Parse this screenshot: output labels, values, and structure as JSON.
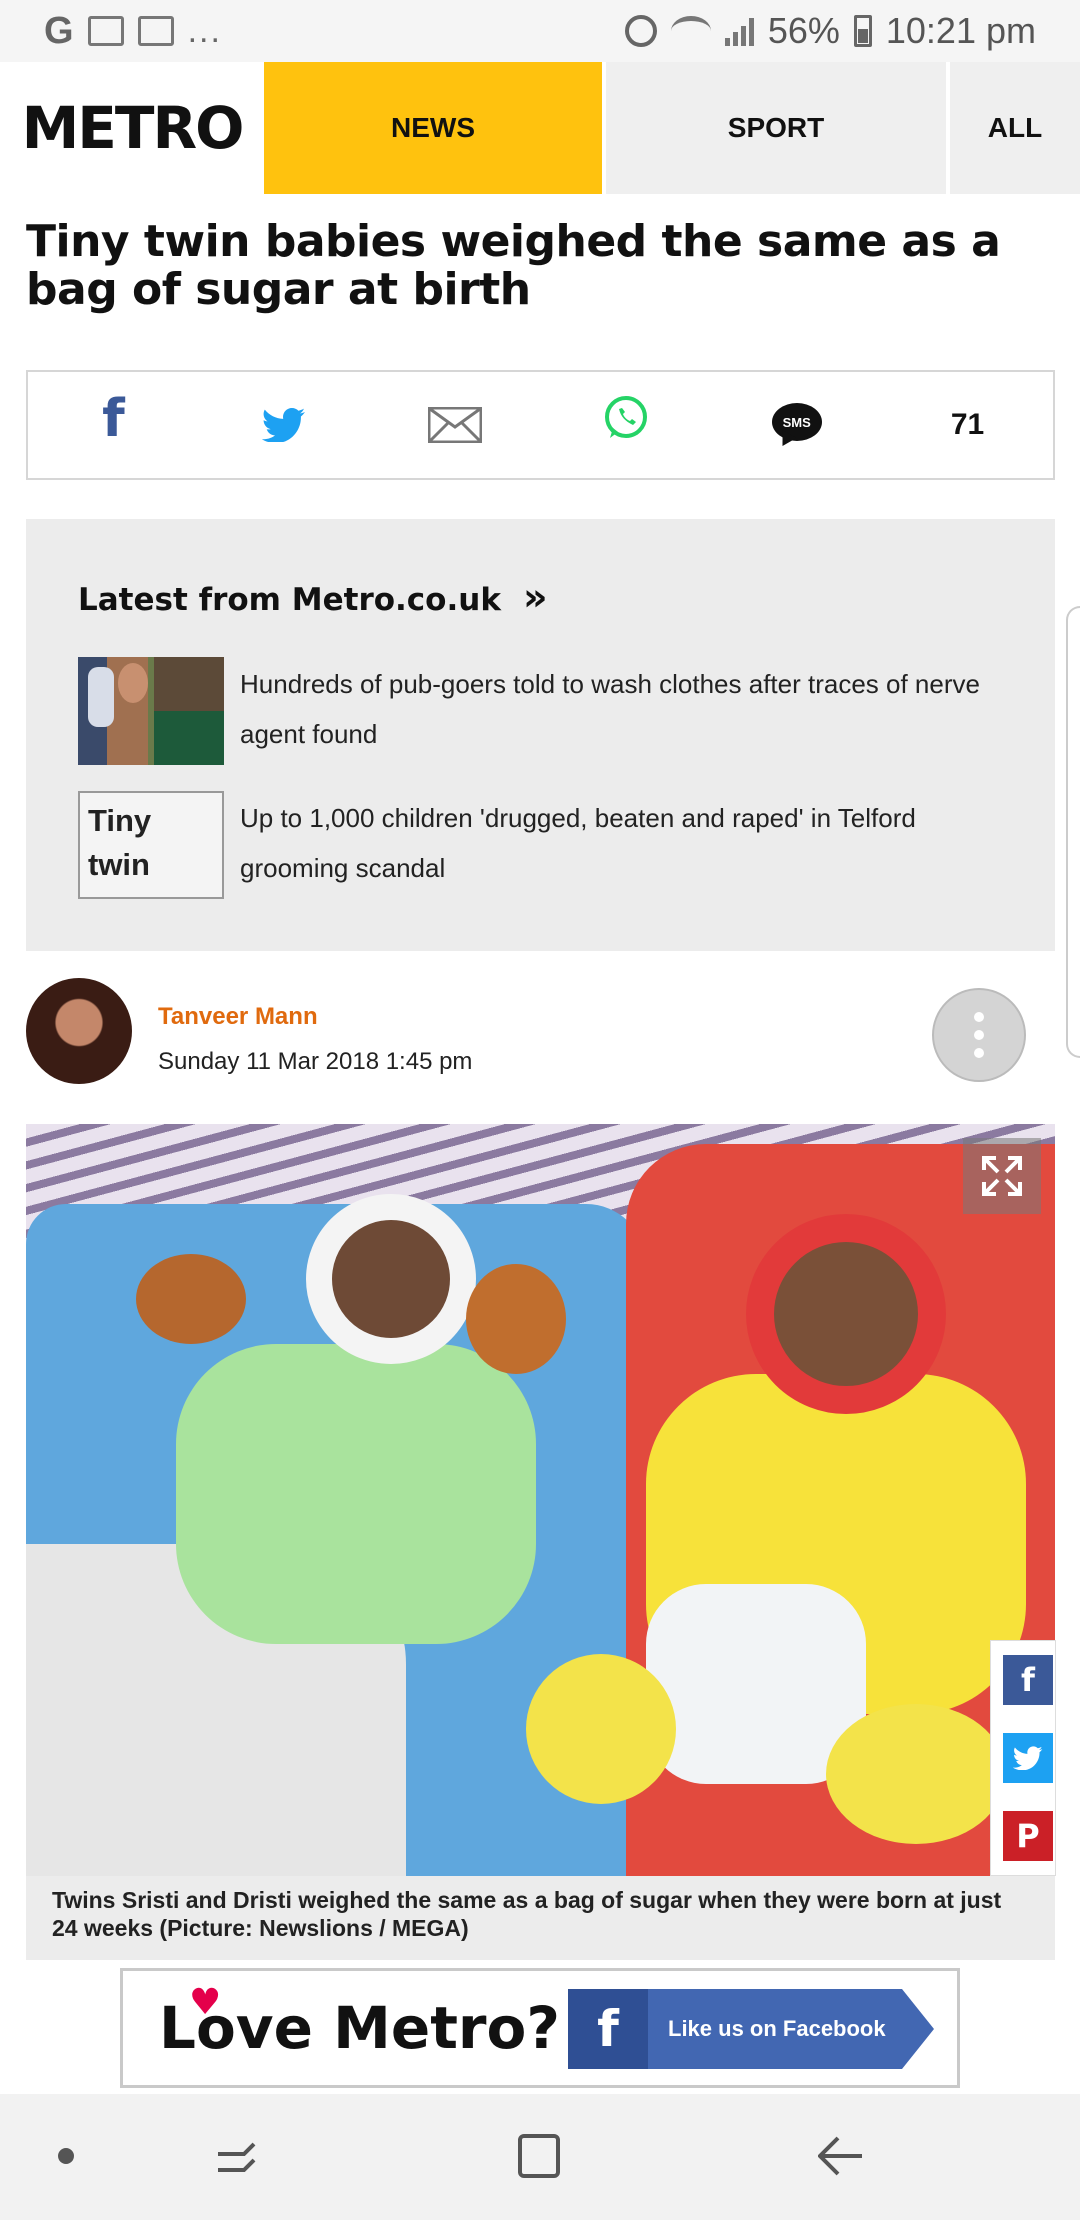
{
  "status_bar": {
    "left_glyph": "G",
    "dots": "...",
    "battery": "56%",
    "time": "10:21 pm"
  },
  "nav": {
    "logo": "METRO",
    "tabs": [
      {
        "label": "NEWS",
        "active": true
      },
      {
        "label": "SPORT",
        "active": false
      },
      {
        "label": "ALL",
        "active": false
      }
    ],
    "accent_color": "#ffc20e"
  },
  "article": {
    "headline": "Tiny twin babies weighed the same as a bag of sugar at birth",
    "share": {
      "facebook_glyph": "f",
      "sms_label": "SMS",
      "count": "71"
    },
    "latest": {
      "title": "Latest from Metro.co.uk",
      "arrow": "»",
      "items": [
        {
          "text": "Hundreds of pub-goers told to wash clothes after traces of nerve agent found"
        },
        {
          "text": "Up to 1,000 children 'drugged, beaten and raped' in Telford grooming scandal",
          "thumb_alt": "Tiny twin"
        }
      ]
    },
    "author": {
      "name": "Tanveer Mann",
      "date": "Sunday 11 Mar 2018 1:45 pm"
    },
    "image": {
      "caption": "Twins Sristi and Dristi weighed the same as a bag of sugar when they were born at just 24 weeks  (Picture: Newslions / MEGA)"
    },
    "side_share": {
      "facebook": "f",
      "pinterest": "P"
    }
  },
  "banner": {
    "text": "Love Metro?",
    "fb_glyph": "f",
    "like_text": "Like us on Facebook"
  },
  "colors": {
    "author_name": "#e06a0e",
    "facebook": "#3b5998",
    "twitter": "#1da1f2",
    "pinterest": "#cb2027",
    "whatsapp": "#25d366"
  }
}
